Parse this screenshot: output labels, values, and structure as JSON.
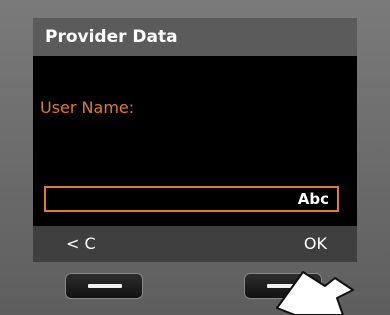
{
  "screen": {
    "title": "Provider Data",
    "field_label": "User Name:",
    "field_value": "",
    "input_mode": "Abc"
  },
  "softkeys": {
    "left": "< C",
    "right": "OK"
  },
  "colors": {
    "accent": "#e07a2c",
    "screen_bg": "#000000",
    "title_bar_bg": "#5b5b5b",
    "softkey_bar_bg": "#3f3f3f"
  }
}
